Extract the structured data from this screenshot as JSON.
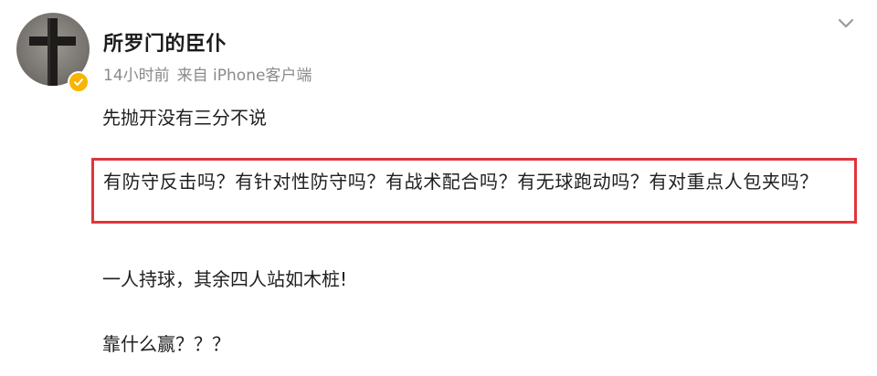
{
  "post": {
    "author": {
      "name": "所罗门的臣仆",
      "verified": true,
      "avatar_icon": "cross-icon",
      "badge_color": "#f7b500"
    },
    "meta": {
      "time": "14小时前",
      "source": "来自 iPhone客户端"
    },
    "menu_icon": "chevron-down-icon",
    "lines": [
      "先抛开没有三分不说",
      "一人持球，其余四人站如木桩!",
      "靠什么赢？？？"
    ],
    "highlighted": {
      "text": "有防守反击吗？有针对性防守吗？有战术配合吗？有无球跑动吗？有对重点人包夹吗？",
      "border_color": "#e0353c"
    }
  }
}
